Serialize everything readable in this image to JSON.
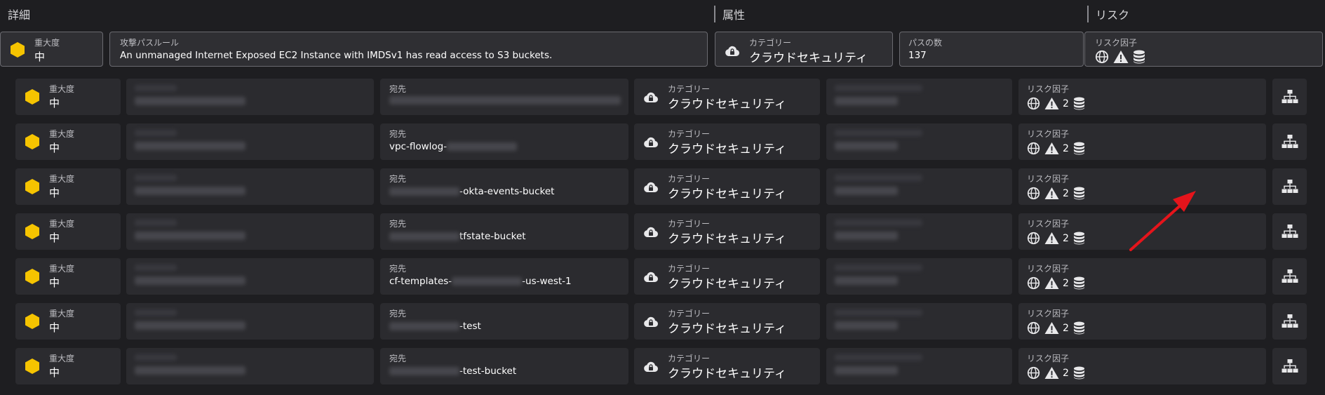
{
  "headers": {
    "details": "詳細",
    "attributes": "属性",
    "risk": "リスク"
  },
  "summary": {
    "severity_label": "重大度",
    "severity_value": "中",
    "rule_label": "攻撃パスルール",
    "rule_value": "An unmanaged Internet Exposed EC2 Instance with IMDSv1 has read access to S3 buckets.",
    "category_label": "カテゴリー",
    "category_value": "クラウドセキュリティ",
    "path_count_label": "パスの数",
    "path_count_value": "137",
    "risk_label": "リスク因子"
  },
  "rows": [
    {
      "severity_label": "重大度",
      "severity_value": "中",
      "dest_label": "宛先",
      "dest_prefix": "",
      "dest_suffix": "",
      "category_label": "カテゴリー",
      "category_value": "クラウドセキュリティ",
      "risk_label": "リスク因子",
      "risk_count": "2"
    },
    {
      "severity_label": "重大度",
      "severity_value": "中",
      "dest_label": "宛先",
      "dest_prefix": "vpc-flowlog-",
      "dest_suffix": "",
      "category_label": "カテゴリー",
      "category_value": "クラウドセキュリティ",
      "risk_label": "リスク因子",
      "risk_count": "2"
    },
    {
      "severity_label": "重大度",
      "severity_value": "中",
      "dest_label": "宛先",
      "dest_prefix": "",
      "dest_suffix": "-okta-events-bucket",
      "category_label": "カテゴリー",
      "category_value": "クラウドセキュリティ",
      "risk_label": "リスク因子",
      "risk_count": "2"
    },
    {
      "severity_label": "重大度",
      "severity_value": "中",
      "dest_label": "宛先",
      "dest_prefix": "",
      "dest_suffix": "tfstate-bucket",
      "category_label": "カテゴリー",
      "category_value": "クラウドセキュリティ",
      "risk_label": "リスク因子",
      "risk_count": "2"
    },
    {
      "severity_label": "重大度",
      "severity_value": "中",
      "dest_label": "宛先",
      "dest_prefix": "cf-templates-",
      "dest_suffix": "-us-west-1",
      "category_label": "カテゴリー",
      "category_value": "クラウドセキュリティ",
      "risk_label": "リスク因子",
      "risk_count": "2"
    },
    {
      "severity_label": "重大度",
      "severity_value": "中",
      "dest_label": "宛先",
      "dest_prefix": "",
      "dest_suffix": "-test",
      "category_label": "カテゴリー",
      "category_value": "クラウドセキュリティ",
      "risk_label": "リスク因子",
      "risk_count": "2"
    },
    {
      "severity_label": "重大度",
      "severity_value": "中",
      "dest_label": "宛先",
      "dest_prefix": "",
      "dest_suffix": "-test-bucket",
      "category_label": "カテゴリー",
      "category_value": "クラウドセキュリティ",
      "risk_label": "リスク因子",
      "risk_count": "2"
    }
  ],
  "icons": {
    "severity": "hexagon-icon",
    "category": "cloud-lock-icon",
    "risk": [
      "globe-icon",
      "warning-icon",
      "database-icon"
    ],
    "action": "tree-icon"
  },
  "colors": {
    "severity_medium": "#f6c400",
    "annotation_arrow": "#e5141b"
  }
}
